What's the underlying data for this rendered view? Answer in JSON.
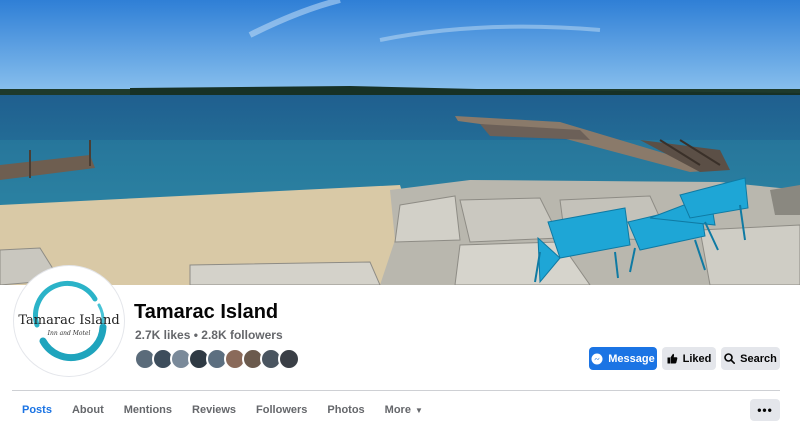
{
  "page": {
    "name": "Tamarac Island",
    "likes": "2.7K likes",
    "separator": "•",
    "followers": "2.8K followers",
    "logo_title": "Tamarac Island",
    "logo_subtitle": "Inn and Motel"
  },
  "follower_avatars": [
    "#5a6b7a",
    "#3d4d5c",
    "#7a8a9a",
    "#2f3a44",
    "#5c6f80",
    "#8a6a5a",
    "#6b5a4d",
    "#4a5560",
    "#3a3f46"
  ],
  "actions": {
    "message_label": "Message",
    "liked_label": "Liked",
    "search_label": "Search"
  },
  "tabs": [
    {
      "label": "Posts",
      "active": true
    },
    {
      "label": "About",
      "active": false
    },
    {
      "label": "Mentions",
      "active": false
    },
    {
      "label": "Reviews",
      "active": false
    },
    {
      "label": "Followers",
      "active": false
    },
    {
      "label": "Photos",
      "active": false
    },
    {
      "label": "More",
      "active": false
    }
  ],
  "more_menu_glyph": "•••",
  "colors": {
    "accent": "#1b74e4",
    "button_gray": "#e4e6eb",
    "text_secondary": "#65676b"
  }
}
